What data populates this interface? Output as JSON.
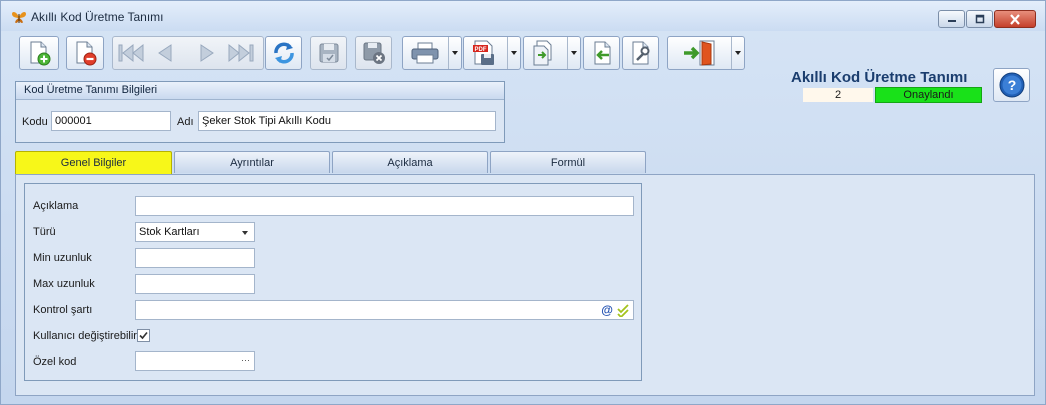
{
  "window": {
    "title": "Akıllı Kod Üretme Tanımı",
    "form_title": "Akıllı Kod Üretme Tanımı",
    "record_number": "2",
    "status": "Onaylandı",
    "status_color": "#19e119"
  },
  "toolbar": {
    "buttons": [
      {
        "name": "new-record-button",
        "icon": "new-document-icon",
        "enabled": true
      },
      {
        "name": "delete-record-button",
        "icon": "delete-document-icon",
        "enabled": true
      },
      {
        "name": "first-record-button",
        "icon": "first-icon",
        "enabled": false
      },
      {
        "name": "previous-record-button",
        "icon": "previous-icon",
        "enabled": false
      },
      {
        "name": "next-record-button",
        "icon": "next-icon",
        "enabled": false
      },
      {
        "name": "last-record-button",
        "icon": "last-icon",
        "enabled": false
      },
      {
        "name": "refresh-button",
        "icon": "refresh-icon",
        "enabled": true
      },
      {
        "name": "save-button",
        "icon": "save-icon",
        "enabled": false
      },
      {
        "name": "save-close-button",
        "icon": "save-close-icon",
        "enabled": false
      },
      {
        "name": "print-button",
        "icon": "printer-icon",
        "enabled": true
      },
      {
        "name": "pdf-export-button",
        "icon": "pdf-icon",
        "enabled": true
      },
      {
        "name": "export-button",
        "icon": "export-icon",
        "enabled": true
      },
      {
        "name": "import-button",
        "icon": "import-icon",
        "enabled": true
      },
      {
        "name": "settings-button",
        "icon": "wrench-document-icon",
        "enabled": true
      },
      {
        "name": "exit-button",
        "icon": "exit-door-icon",
        "enabled": true
      }
    ]
  },
  "header_group": {
    "title": "Kod Üretme Tanımı Bilgileri",
    "code_label": "Kodu",
    "code_value": "000001",
    "name_label": "Adı",
    "name_value": "Şeker Stok Tipi Akıllı Kodu"
  },
  "tabs": [
    {
      "label": "Genel Bilgiler",
      "active": true
    },
    {
      "label": "Ayrıntılar",
      "active": false
    },
    {
      "label": "Açıklama",
      "active": false
    },
    {
      "label": "Formül",
      "active": false
    }
  ],
  "general": {
    "description_label": "Açıklama",
    "description_value": "",
    "type_label": "Türü",
    "type_value": "Stok Kartları",
    "min_length_label": "Min uzunluk",
    "min_length_value": "",
    "max_length_label": "Max uzunluk",
    "max_length_value": "",
    "control_condition_label": "Kontrol şartı",
    "control_condition_value": "",
    "control_at_symbol": "@",
    "user_editable_label": "Kullanıcı değiştirebilir",
    "user_editable_checked": true,
    "special_code_label": "Özel kod",
    "special_code_value": "",
    "special_code_ellipsis": "···"
  }
}
